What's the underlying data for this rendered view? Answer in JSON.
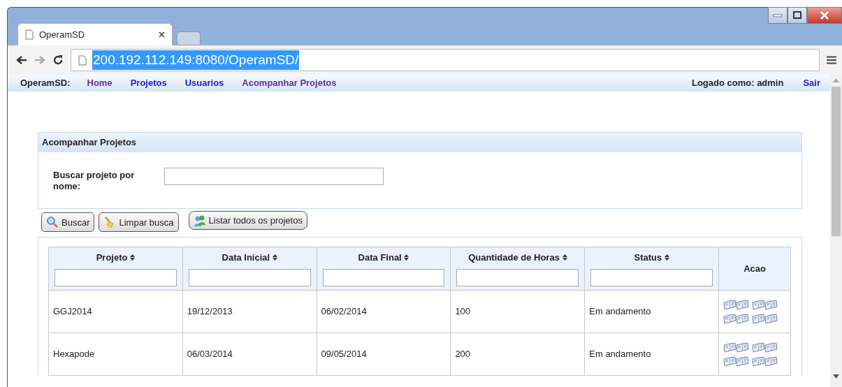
{
  "browser": {
    "tabs": [
      {
        "title": "OperamSD",
        "selected": true
      }
    ],
    "url": "200.192.112.149:8080/OperamSD/"
  },
  "nav": {
    "brand": "OperamSD:",
    "links": [
      {
        "label": "Home",
        "visited": true
      },
      {
        "label": "Projetos",
        "visited": false
      },
      {
        "label": "Usuarios",
        "visited": false
      },
      {
        "label": "Acompanhar Projetos",
        "visited": true
      }
    ],
    "user": "Logado como: admin",
    "logout": "Sair"
  },
  "panel": {
    "title": "Acompanhar Projetos",
    "search_label": "Buscar projeto por nome:"
  },
  "buttons": [
    {
      "label": "Buscar",
      "kind": "search"
    },
    {
      "label": "Limpar busca",
      "kind": "clear"
    },
    {
      "label": "Listar todos os projetos",
      "kind": "list"
    }
  ],
  "table": {
    "columns": [
      {
        "label": "Projeto",
        "sortable": true
      },
      {
        "label": "Data Inicial",
        "sortable": true
      },
      {
        "label": "Data Final",
        "sortable": true
      },
      {
        "label": "Quantidade de Horas",
        "sortable": true
      },
      {
        "label": "Status",
        "sortable": true
      },
      {
        "label": "Acao",
        "sortable": false
      }
    ],
    "rows": [
      [
        "GGJ2014",
        "19/12/2013",
        "06/02/2014",
        "100",
        "Em andamento"
      ],
      [
        "Hexapode",
        "06/03/2014",
        "09/05/2014",
        "200",
        "Em andamento"
      ]
    ]
  }
}
